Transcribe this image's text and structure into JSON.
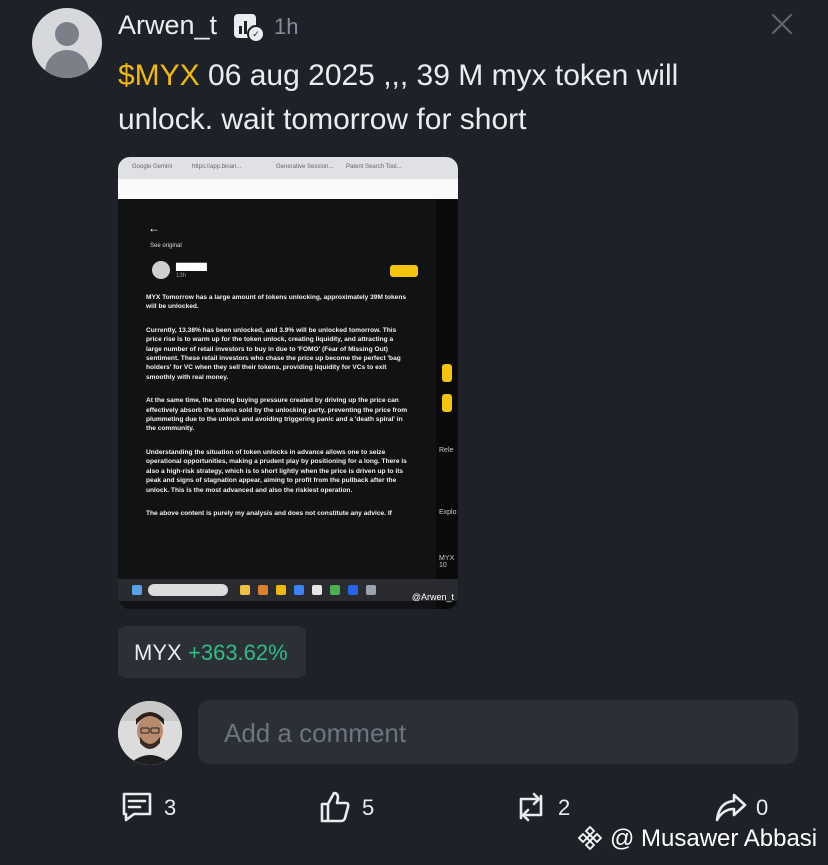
{
  "post": {
    "username": "Arwen_t",
    "time_ago": "1h",
    "ticker": "$MYX",
    "text": " 06 aug 2025 ,,, 39 M myx token will unlock. wait tomorrow for short"
  },
  "embedded_screenshot": {
    "tabs": [
      "Google Gemini",
      "https://app.binan...",
      "Generative Session...",
      "Patent Search Tool..."
    ],
    "back": "←",
    "see_original": "See original",
    "author_time": "13h",
    "paragraphs": [
      "MYX Tomorrow has a large amount of tokens unlocking, approximately 39M tokens will be unlocked.",
      "Currently, 13.38% has been unlocked, and 3.9% will be unlocked tomorrow. This price rise is to warm up for the token unlock, creating liquidity, and attracting a large number of retail investors to buy in due to 'FOMO' (Fear of Missing Out) sentiment. These retail investors who chase the price up become the perfect 'bag holders' for VC when they sell their tokens, providing liquidity for VCs to exit smoothly with real money.",
      "At the same time, the strong buying pressure created by driving up the price can effectively absorb the tokens sold by the unlocking party, preventing the price from plummeting due to the unlock and avoiding triggering panic and a 'death spiral' in the community.",
      "Understanding the situation of token unlocks in advance allows one to seize operational opportunities, making a prudent play by positioning for a long. There is also a high-risk strategy, which is to short lightly when the price is driven up to its peak and signs of stagnation appear, aiming to profit from the pullback after the unlock. This is the most advanced and also the riskiest operation.",
      "The above content is purely my analysis and does not constitute any advice. If"
    ],
    "sidebar_labels": [
      "Rele",
      "Explo",
      "MYX 10"
    ],
    "watermark": "@Arwen_t"
  },
  "pnl": {
    "symbol": "MYX",
    "change": "+363.62%",
    "change_color": "#2ebd85"
  },
  "comment": {
    "placeholder": "Add a comment"
  },
  "actions": {
    "comments": "3",
    "likes": "5",
    "reposts": "2",
    "shares": "0"
  },
  "watermark": {
    "text": "@ Musawer Abbasi"
  },
  "colors": {
    "background": "#1f2129",
    "accent": "#f0b90b",
    "positive": "#2ebd85",
    "chip": "#2b2f36"
  },
  "icons": [
    "user-avatar-icon",
    "creator-badge-icon",
    "close-icon",
    "comment-icon",
    "like-icon",
    "repost-icon",
    "share-icon",
    "binance-logo-icon"
  ]
}
